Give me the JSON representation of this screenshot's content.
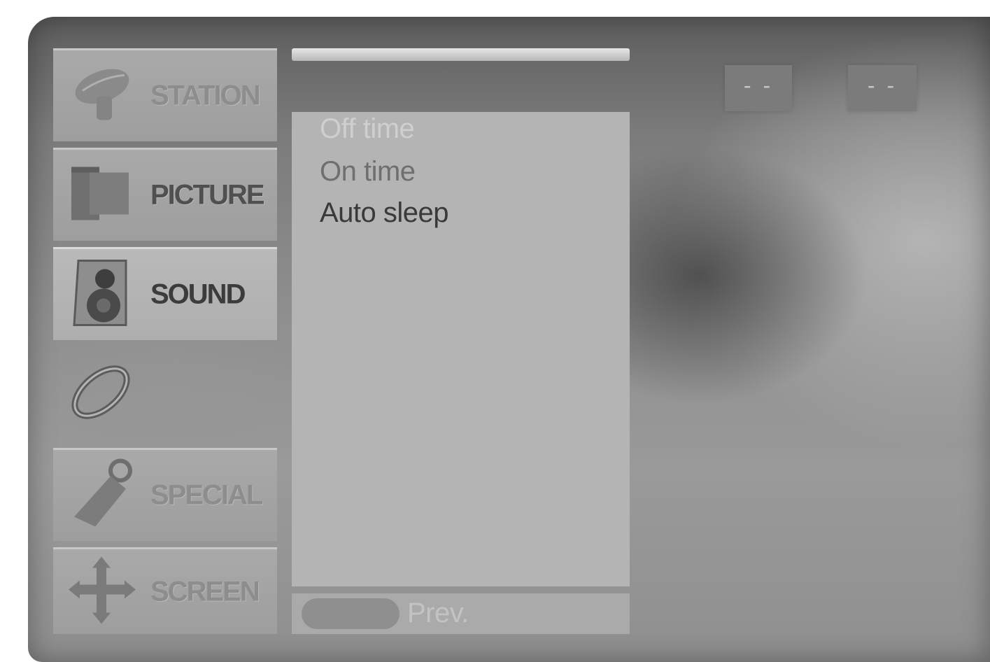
{
  "nav": {
    "items": [
      {
        "label": "STATION",
        "icon": "satellite-dish-icon"
      },
      {
        "label": "PICTURE",
        "icon": "tv-picture-icon"
      },
      {
        "label": "SOUND",
        "icon": "speaker-icon"
      },
      {
        "label": "",
        "icon": "timer-ring-icon"
      },
      {
        "label": "SPECIAL",
        "icon": "plug-icon"
      },
      {
        "label": "SCREEN",
        "icon": "move-arrows-icon"
      }
    ]
  },
  "submenu": {
    "items": [
      "Off time",
      "On time",
      "Auto sleep"
    ]
  },
  "footer": {
    "prev_label": "Prev."
  },
  "time_display": {
    "hours": "- -",
    "minutes": "- -"
  }
}
